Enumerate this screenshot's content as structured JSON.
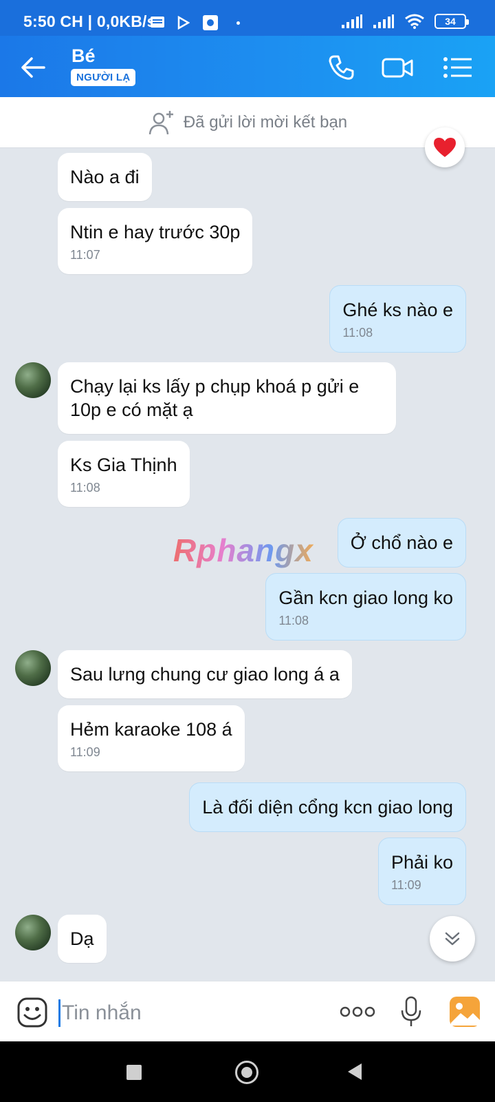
{
  "status_bar": {
    "time": "5:50 CH | 0,0KB/s",
    "battery": "34"
  },
  "header": {
    "contact_name": "Bé",
    "badge": "NGƯỜI LẠ",
    "icons": [
      "back-arrow-icon",
      "phone-icon",
      "video-call-icon",
      "menu-list-icon"
    ]
  },
  "friend_banner": {
    "text": "Đã gửi lời mời kết bạn"
  },
  "messages": [
    {
      "side": "in",
      "text": "Nào a đi",
      "time": ""
    },
    {
      "side": "in",
      "text": "Ntin e hay trước 30p",
      "time": "11:07"
    },
    {
      "side": "out",
      "text": "Ghé ks nào e",
      "time": "11:08"
    },
    {
      "side": "in",
      "text": "Chạy lại ks lấy p chụp khoá p gửi e 10p e có mặt ạ",
      "time": ""
    },
    {
      "side": "in",
      "text": "Ks Gia Thịnh",
      "time": "11:08"
    },
    {
      "side": "out",
      "text": "Ở chổ nào e",
      "time": ""
    },
    {
      "side": "out",
      "text": "Gần kcn giao long ko",
      "time": "11:08"
    },
    {
      "side": "in",
      "text": "Sau lưng chung cư giao long á a",
      "time": ""
    },
    {
      "side": "in",
      "text": "Hẻm karaoke 108 á",
      "time": "11:09"
    },
    {
      "side": "out",
      "text": "Là đối diện cổng kcn giao long",
      "time": ""
    },
    {
      "side": "out",
      "text": "Phải ko",
      "time": "11:09"
    },
    {
      "side": "in",
      "text": "Dạ",
      "time": ""
    }
  ],
  "watermark": "Rphangx",
  "input": {
    "placeholder": "Tin nhắn"
  },
  "colors": {
    "header_blue": "#1b78e8",
    "outgoing_bubble": "#d4ecfd",
    "incoming_bubble": "#ffffff",
    "chat_background": "#e1e6ec"
  }
}
